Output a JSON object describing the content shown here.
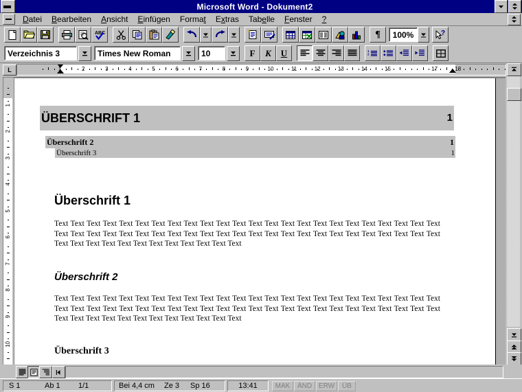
{
  "window": {
    "title": "Microsoft Word - Dokument2",
    "minimize_label": "▼",
    "restore_label": "▲▼",
    "doc_restore_label": "▲▼"
  },
  "menubar": {
    "items": [
      {
        "label": "Datei",
        "accel_index": 0
      },
      {
        "label": "Bearbeiten",
        "accel_index": 0
      },
      {
        "label": "Ansicht",
        "accel_index": 0
      },
      {
        "label": "Einfügen",
        "accel_index": 0
      },
      {
        "label": "Format",
        "accel_index": 5
      },
      {
        "label": "Extras",
        "accel_index": 1
      },
      {
        "label": "Tabelle",
        "accel_index": 3
      },
      {
        "label": "Fenster",
        "accel_index": 0
      },
      {
        "label": "?",
        "accel_index": -1
      }
    ]
  },
  "standard_toolbar": {
    "buttons": [
      {
        "name": "new-document-icon",
        "tip": "Neu"
      },
      {
        "name": "open-folder-icon",
        "tip": "Öffnen"
      },
      {
        "name": "save-disk-icon",
        "tip": "Speichern"
      },
      {
        "name": "printer-icon",
        "tip": "Drucken"
      },
      {
        "name": "print-preview-icon",
        "tip": "Seitenansicht"
      },
      {
        "name": "spellcheck-abc-icon",
        "tip": "Rechtschreibung"
      },
      {
        "name": "cut-scissors-icon",
        "tip": "Ausschneiden"
      },
      {
        "name": "copy-icon",
        "tip": "Kopieren"
      },
      {
        "name": "paste-clipboard-icon",
        "tip": "Einfügen"
      },
      {
        "name": "format-painter-brush-icon",
        "tip": "Format übertragen"
      },
      {
        "name": "undo-arrow-icon",
        "tip": "Rückgängig"
      },
      {
        "name": "undo-dropdown-icon",
        "tip": "Rückgängig Liste"
      },
      {
        "name": "redo-arrow-icon",
        "tip": "Wiederherstellen"
      },
      {
        "name": "redo-dropdown-icon",
        "tip": "Wiederherstellen Liste"
      },
      {
        "name": "autoformat-icon",
        "tip": "AutoFormat"
      },
      {
        "name": "autotext-icon",
        "tip": "AutoText"
      },
      {
        "name": "insert-table-icon",
        "tip": "Tabelle einfügen"
      },
      {
        "name": "insert-excel-table-icon",
        "tip": "Excel-Tabelle einfügen"
      },
      {
        "name": "columns-icon",
        "tip": "Spalten"
      },
      {
        "name": "drawing-icon",
        "tip": "Zeichnen"
      },
      {
        "name": "chart-icon",
        "tip": "Diagramm"
      },
      {
        "name": "show-paragraph-marks-icon",
        "tip": "Einblenden/Ausblenden ¶"
      },
      {
        "name": "help-pointer-icon",
        "tip": "Direkthilfe"
      }
    ],
    "paragraph_mark": "¶",
    "zoom_value": "100%",
    "help_label": "?"
  },
  "formatting_toolbar": {
    "style": {
      "value": "Verzeichnis 3",
      "dropdown": "▼"
    },
    "font": {
      "value": "Times New Roman",
      "dropdown": "▼"
    },
    "size": {
      "value": "10",
      "dropdown": "▼"
    },
    "bold_label": "F",
    "italic_label": "K",
    "underline_label": "U",
    "align_buttons": [
      "align-left",
      "align-center",
      "align-right",
      "align-justify"
    ],
    "list_buttons": [
      "numbered-list",
      "bulleted-list",
      "decrease-indent",
      "increase-indent"
    ],
    "borders_label": "borders"
  },
  "ruler": {
    "tab_selector_glyph": "L",
    "h_numbers": [
      "1",
      "2",
      "3",
      "4",
      "5",
      "6",
      "7",
      "8",
      "9",
      "10",
      "11",
      "12",
      "13",
      "14",
      "15",
      "17",
      "18"
    ],
    "v_numbers": [
      "1",
      "2",
      "3",
      "4",
      "5",
      "6",
      "7",
      "8",
      "9",
      "10"
    ],
    "scroll_glyph": "▲"
  },
  "document": {
    "toc": {
      "entries": [
        {
          "text": "ÜBERSCHRIFT 1",
          "page": "1",
          "level": 1
        },
        {
          "text": "Überschrift 2",
          "page": "1",
          "level": 2
        },
        {
          "text": "Überschrift 3",
          "page": "1",
          "level": 3
        }
      ],
      "selected": true
    },
    "sections": [
      {
        "heading": "Überschrift 1",
        "level": 1,
        "body": "Text Text Text Text Text Text Text Text Text Text Text Text Text Text Text Text Text Text Text Text Text Text Text Text Text Text Text Text Text Text Text Text Text Text Text Text Text Text Text Text Text Text Text Text Text Text Text Text Text Text Text Text Text Text Text Text Text Text Text Text"
      },
      {
        "heading": "Überschrift 2",
        "level": 2,
        "body": "Text Text Text Text Text Text Text Text Text Text Text Text Text Text Text Text Text Text Text Text Text Text Text Text Text Text Text Text Text Text Text Text Text Text Text Text Text Text Text Text Text Text Text Text Text Text Text Text Text Text Text Text Text Text Text Text Text Text Text Text"
      },
      {
        "heading": "Überschrift 3",
        "level": 3,
        "body": ""
      }
    ]
  },
  "scrollbars": {
    "up_glyph": "▲",
    "down_glyph": "▼",
    "prev_page_glyph": "⏶",
    "next_page_glyph": "⏷",
    "left_glyph": "◀",
    "right_glyph": "▶"
  },
  "view_buttons": [
    {
      "name": "normal-view-button",
      "active": false
    },
    {
      "name": "page-layout-view-button",
      "active": true
    },
    {
      "name": "outline-view-button",
      "active": false
    }
  ],
  "statusbar": {
    "page": "S  1",
    "section": "Ab 1",
    "pages": "1/1",
    "position": "Bei 4,4 cm",
    "line": "Ze 3",
    "column": "Sp 16",
    "time": "13:41",
    "flags": [
      {
        "label": "MAK",
        "active": false
      },
      {
        "label": "ÄND",
        "active": false
      },
      {
        "label": "ERW",
        "active": false
      },
      {
        "label": "ÜB",
        "active": false
      }
    ]
  },
  "colors": {
    "titlebar": "#000082",
    "face": "#c0c0c0",
    "selection": "#c0c0c0",
    "desk": "#808080"
  }
}
